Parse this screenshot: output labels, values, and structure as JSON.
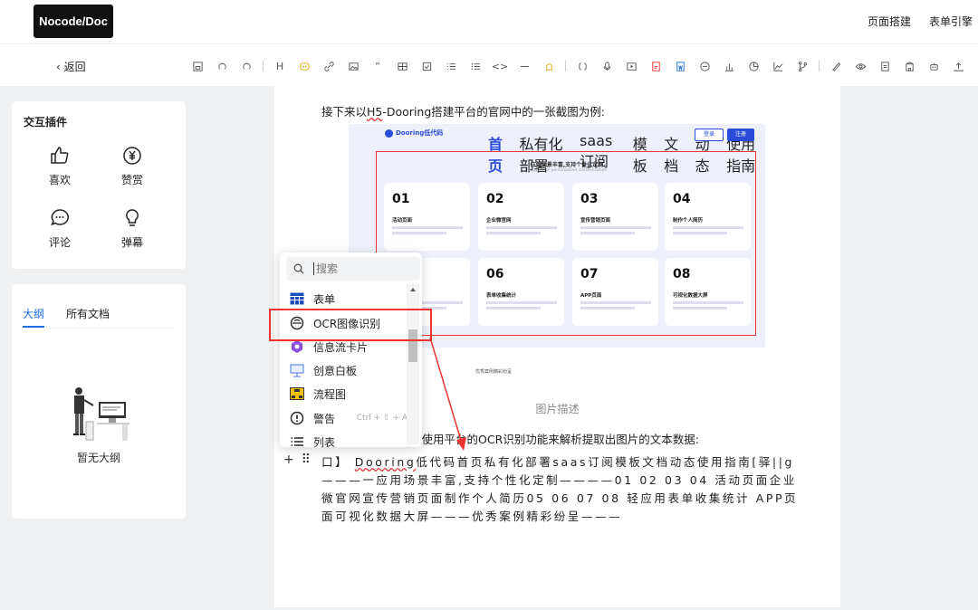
{
  "header": {
    "logo": "Nocode/Doc",
    "links": [
      "页面搭建",
      "表单引擎"
    ]
  },
  "toolbar": {
    "back_label": "返回",
    "heading_tool": "H",
    "quote_tool": "”",
    "code_tool": "<>"
  },
  "plugins": {
    "title": "交互插件",
    "items": [
      {
        "label": "喜欢",
        "icon": "thumb-up-icon"
      },
      {
        "label": "赞赏",
        "icon": "yen-reward-icon"
      },
      {
        "label": "评论",
        "icon": "comment-icon"
      },
      {
        "label": "弹幕",
        "icon": "bulb-icon"
      }
    ]
  },
  "outline": {
    "tabs": [
      "大纲",
      "所有文档"
    ],
    "empty_text": "暂无大纲"
  },
  "editor": {
    "intro_pre": "接下来以",
    "intro_u": "H5",
    "intro_post": "-Dooring搭建平台的官网中的一张截图为例:",
    "caption": "图片描述",
    "para2": "们使用平台的OCR识别功能来解析提取出图片的文本数据:",
    "para3_pre": "口】",
    "para3_u": "Dooring",
    "para3_post": "低代码首页私有化部署saas订阅模板文档动态使用指南[驿||g———一应用场景丰富,支持个性化定制————01 02 03 04 活动页面企业微官网宣传营销页面制作个人简历05 06 07 08 轻应用表单收集统计 APP页面可视化数据大屏———优秀案例精彩纷呈———"
  },
  "screenshot": {
    "logo": "Dooring低代码",
    "menu": [
      "首页",
      "私有化部署",
      "saas订阅",
      "模板",
      "文档",
      "动态",
      "使用指南"
    ],
    "login": "登录",
    "register": "注册",
    "heading": "应用场景丰富,支持个性化定制",
    "subheading": "Support for personalized customization",
    "cards": [
      {
        "num": "01",
        "title": "活动页面"
      },
      {
        "num": "02",
        "title": "企业微官网"
      },
      {
        "num": "03",
        "title": "宣传营销页面"
      },
      {
        "num": "04",
        "title": "制作个人简历"
      },
      {
        "num": "05",
        "title": ""
      },
      {
        "num": "06",
        "title": "表单收集统计"
      },
      {
        "num": "07",
        "title": "APP页面"
      },
      {
        "num": "08",
        "title": "可视化数据大屏"
      }
    ],
    "footer": "优秀案例精彩纷呈"
  },
  "dropdown": {
    "search_placeholder": "搜索",
    "items": [
      {
        "label": "表单",
        "icon": "table-form-icon",
        "shortcut": ""
      },
      {
        "label": "OCR图像识别",
        "icon": "ocr-icon",
        "shortcut": ""
      },
      {
        "label": "信息流卡片",
        "icon": "feed-card-icon",
        "shortcut": ""
      },
      {
        "label": "创意白板",
        "icon": "whiteboard-icon",
        "shortcut": ""
      },
      {
        "label": "流程图",
        "icon": "flowchart-icon",
        "shortcut": ""
      },
      {
        "label": "警告",
        "icon": "warning-icon",
        "shortcut": "Ctrl + ⇧ + A"
      },
      {
        "label": "列表",
        "icon": "list-icon",
        "shortcut": ""
      }
    ]
  },
  "colors": {
    "accent": "#1d6fe0",
    "highlight": "#e33333",
    "logo_bg": "#111111"
  }
}
